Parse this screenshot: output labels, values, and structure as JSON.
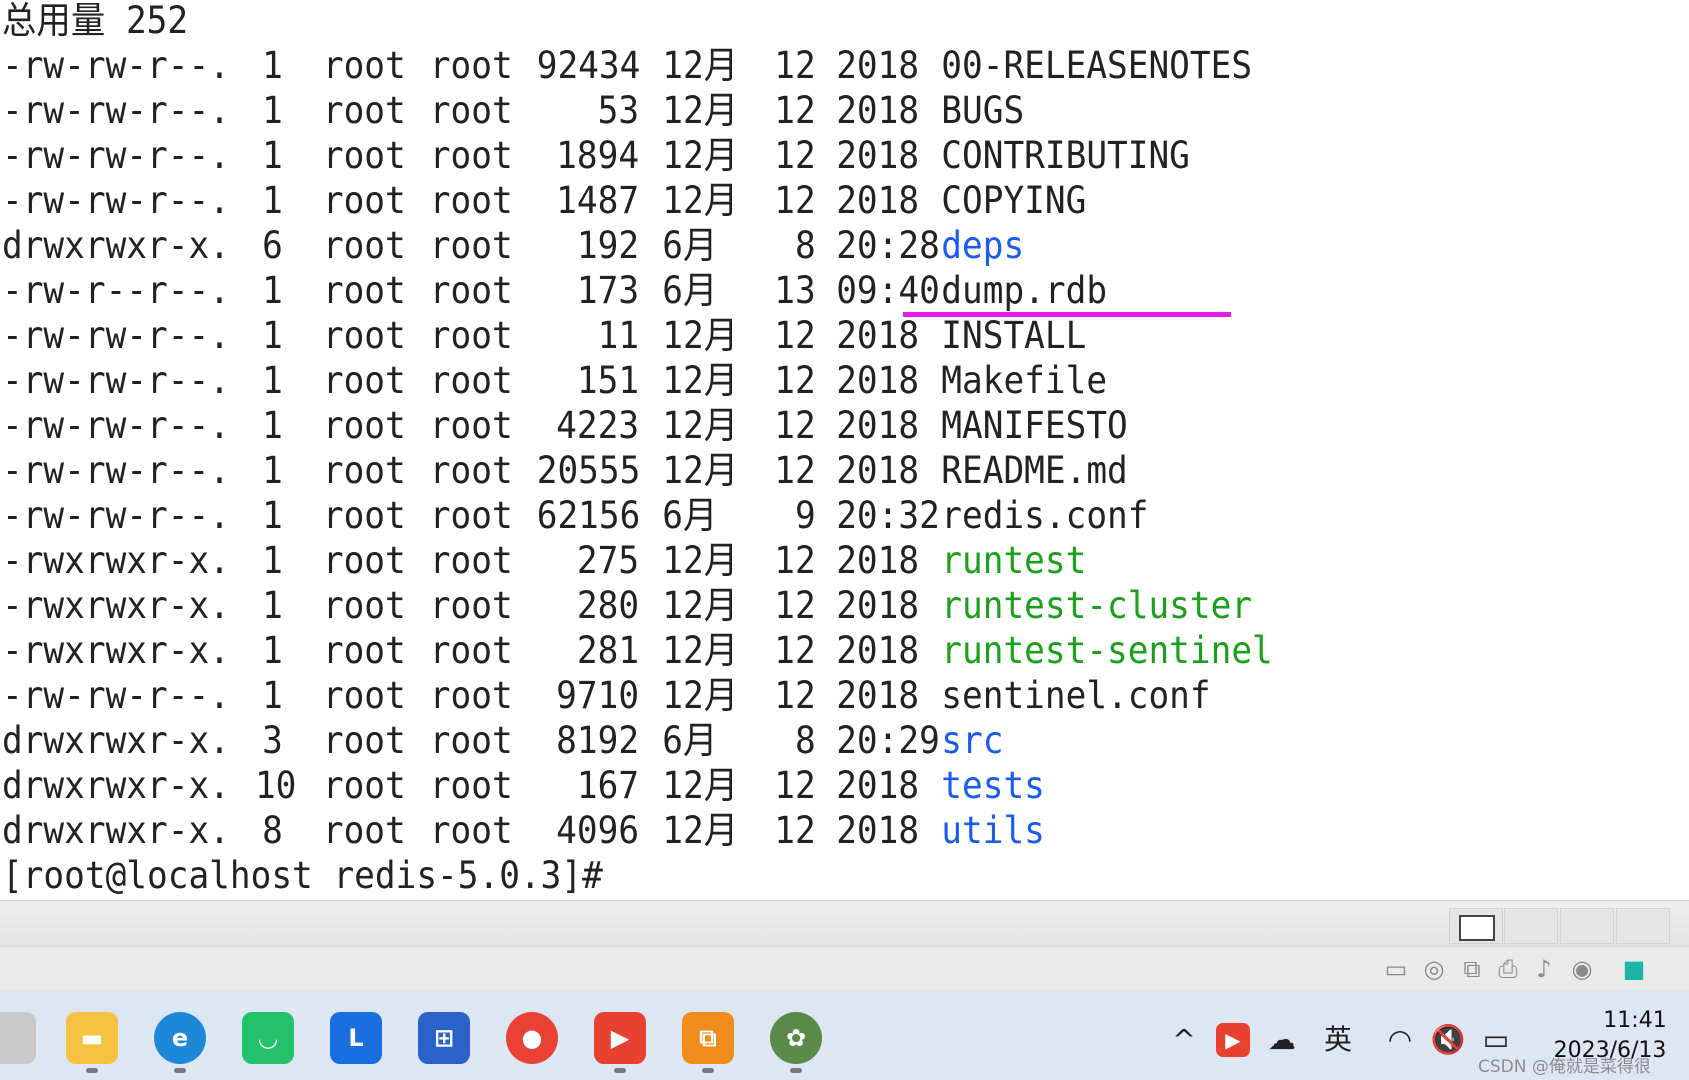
{
  "terminal": {
    "total_line": "总用量 252",
    "rows": [
      {
        "perms": "-rw-rw-r--.",
        "links": "1",
        "owner": "root",
        "group": "root",
        "size": "92434",
        "month": "12月",
        "day": "12",
        "time": "2018",
        "name": "00-RELEASENOTES",
        "kind": "plain"
      },
      {
        "perms": "-rw-rw-r--.",
        "links": "1",
        "owner": "root",
        "group": "root",
        "size": "53",
        "month": "12月",
        "day": "12",
        "time": "2018",
        "name": "BUGS",
        "kind": "plain"
      },
      {
        "perms": "-rw-rw-r--.",
        "links": "1",
        "owner": "root",
        "group": "root",
        "size": "1894",
        "month": "12月",
        "day": "12",
        "time": "2018",
        "name": "CONTRIBUTING",
        "kind": "plain"
      },
      {
        "perms": "-rw-rw-r--.",
        "links": "1",
        "owner": "root",
        "group": "root",
        "size": "1487",
        "month": "12月",
        "day": "12",
        "time": "2018",
        "name": "COPYING",
        "kind": "plain"
      },
      {
        "perms": "drwxrwxr-x.",
        "links": "6",
        "owner": "root",
        "group": "root",
        "size": "192",
        "month": "6月",
        "day": "8",
        "time": "20:28",
        "name": "deps",
        "kind": "dir"
      },
      {
        "perms": "-rw-r--r--.",
        "links": "1",
        "owner": "root",
        "group": "root",
        "size": "173",
        "month": "6月",
        "day": "13",
        "time": "09:40",
        "name": "dump.rdb",
        "kind": "plain"
      },
      {
        "perms": "-rw-rw-r--.",
        "links": "1",
        "owner": "root",
        "group": "root",
        "size": "11",
        "month": "12月",
        "day": "12",
        "time": "2018",
        "name": "INSTALL",
        "kind": "plain"
      },
      {
        "perms": "-rw-rw-r--.",
        "links": "1",
        "owner": "root",
        "group": "root",
        "size": "151",
        "month": "12月",
        "day": "12",
        "time": "2018",
        "name": "Makefile",
        "kind": "plain"
      },
      {
        "perms": "-rw-rw-r--.",
        "links": "1",
        "owner": "root",
        "group": "root",
        "size": "4223",
        "month": "12月",
        "day": "12",
        "time": "2018",
        "name": "MANIFESTO",
        "kind": "plain"
      },
      {
        "perms": "-rw-rw-r--.",
        "links": "1",
        "owner": "root",
        "group": "root",
        "size": "20555",
        "month": "12月",
        "day": "12",
        "time": "2018",
        "name": "README.md",
        "kind": "plain"
      },
      {
        "perms": "-rw-rw-r--.",
        "links": "1",
        "owner": "root",
        "group": "root",
        "size": "62156",
        "month": "6月",
        "day": "9",
        "time": "20:32",
        "name": "redis.conf",
        "kind": "plain"
      },
      {
        "perms": "-rwxrwxr-x.",
        "links": "1",
        "owner": "root",
        "group": "root",
        "size": "275",
        "month": "12月",
        "day": "12",
        "time": "2018",
        "name": "runtest",
        "kind": "exec"
      },
      {
        "perms": "-rwxrwxr-x.",
        "links": "1",
        "owner": "root",
        "group": "root",
        "size": "280",
        "month": "12月",
        "day": "12",
        "time": "2018",
        "name": "runtest-cluster",
        "kind": "exec"
      },
      {
        "perms": "-rwxrwxr-x.",
        "links": "1",
        "owner": "root",
        "group": "root",
        "size": "281",
        "month": "12月",
        "day": "12",
        "time": "2018",
        "name": "runtest-sentinel",
        "kind": "exec"
      },
      {
        "perms": "-rw-rw-r--.",
        "links": "1",
        "owner": "root",
        "group": "root",
        "size": "9710",
        "month": "12月",
        "day": "12",
        "time": "2018",
        "name": "sentinel.conf",
        "kind": "plain"
      },
      {
        "perms": "drwxrwxr-x.",
        "links": "3",
        "owner": "root",
        "group": "root",
        "size": "8192",
        "month": "6月",
        "day": "8",
        "time": "20:29",
        "name": "src",
        "kind": "dir"
      },
      {
        "perms": "drwxrwxr-x.",
        "links": "10",
        "owner": "root",
        "group": "root",
        "size": "167",
        "month": "12月",
        "day": "12",
        "time": "2018",
        "name": "tests",
        "kind": "dir"
      },
      {
        "perms": "drwxrwxr-x.",
        "links": "8",
        "owner": "root",
        "group": "root",
        "size": "4096",
        "month": "12月",
        "day": "12",
        "time": "2018",
        "name": "utils",
        "kind": "dir"
      }
    ],
    "prompt": "[root@localhost redis-5.0.3]#",
    "colors": {
      "dir": "#1a5bf0",
      "exec": "#1ca01c",
      "text": "#222222",
      "highlight": "#e81ce8"
    }
  },
  "vm_devices": [
    "hard-disk-icon",
    "optical-drive-icon",
    "network-icon",
    "printer-icon",
    "sound-icon",
    "usb-icon",
    "note-icon"
  ],
  "taskbar": {
    "apps": [
      "file-explorer-icon",
      "edge-icon",
      "wechat-work-icon",
      "lenovo-icon",
      "store-icon",
      "chrome-icon",
      "wps-icon",
      "vmware-icon",
      "photo-icon"
    ],
    "tray": {
      "chevron": "^",
      "ime": "英"
    },
    "clock_time": "11:41",
    "clock_date": "2023/6/13"
  },
  "watermark": "CSDN @俺就是菜得很"
}
